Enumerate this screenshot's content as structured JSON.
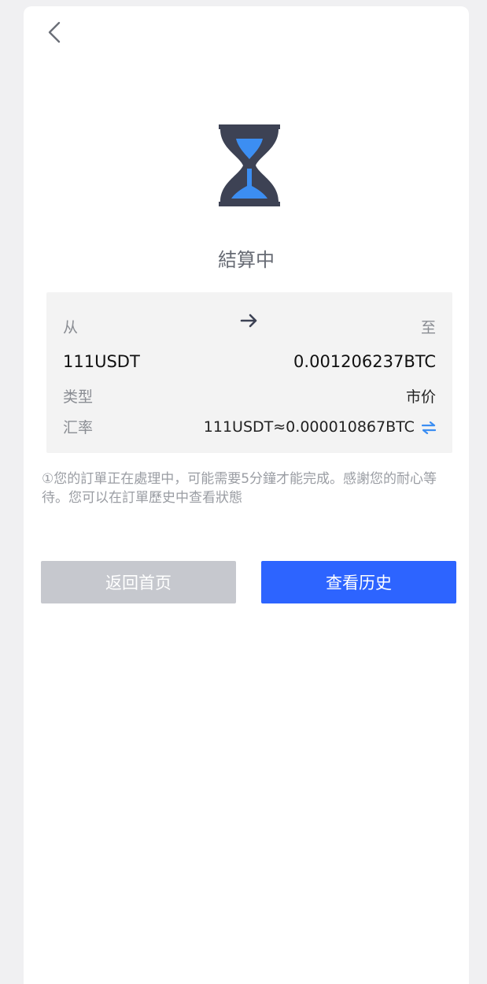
{
  "status": {
    "title": "結算中",
    "icon": "hourglass-icon"
  },
  "exchange": {
    "from_label": "从",
    "to_label": "至",
    "from_amount": "111USDT",
    "to_amount": "0.001206237BTC",
    "type_label": "类型",
    "type_value": "市价",
    "rate_label": "汇率",
    "rate_value": "111USDT≈0.000010867BTC"
  },
  "notice": "①您的訂單正在處理中，可能需要5分鐘才能完成。感謝您的耐心等待。您可以在訂單歷史中查看狀態",
  "buttons": {
    "home": "返回首页",
    "history": "查看历史"
  },
  "colors": {
    "accent": "#2d64ff",
    "disabled": "#c6c8ce",
    "hourglass_dark": "#3d4254",
    "hourglass_sand": "#3c8ef2"
  }
}
